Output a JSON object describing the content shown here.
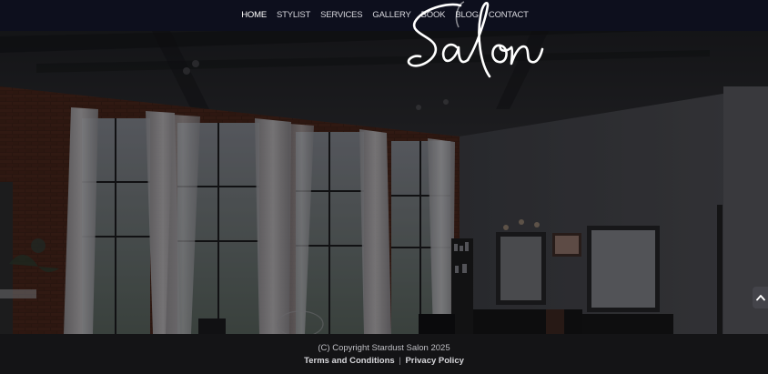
{
  "nav": {
    "items": [
      {
        "label": "HOME",
        "active": true
      },
      {
        "label": "STYLIST",
        "active": false
      },
      {
        "label": "SERVICES",
        "active": false
      },
      {
        "label": "GALLERY",
        "active": false
      },
      {
        "label": "BOOK",
        "active": false
      },
      {
        "label": "BLOG",
        "active": false
      },
      {
        "label": "CONTACT",
        "active": false
      }
    ]
  },
  "logo": {
    "text": "Salon"
  },
  "footer": {
    "copyright": "(C) Copyright Stardust Salon 2025",
    "terms_label": "Terms and Conditions",
    "separator": "|",
    "privacy_label": "Privacy Policy"
  },
  "back_to_top": {
    "icon": "chevron-up-icon"
  },
  "colors": {
    "navbar_bg": "#0d0f1e",
    "footer_bg": "#141416",
    "nav_text": "#d9d9df",
    "brick": "#6e3a2a"
  }
}
